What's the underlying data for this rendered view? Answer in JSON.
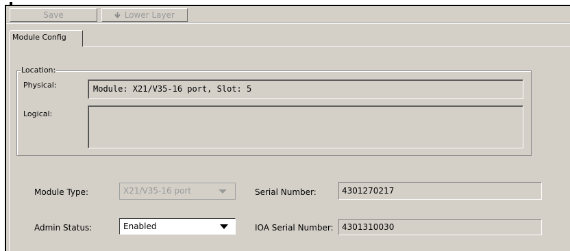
{
  "toolbar": {
    "save_label": "Save",
    "lower_layer_label": "Lower Layer",
    "lower_layer_icon": "down-arrow-icon"
  },
  "tabs": [
    {
      "label": "Module Config",
      "selected": true
    }
  ],
  "location": {
    "legend": "Location:",
    "physical_label": "Physical:",
    "physical_value": "Module: X21/V35-16 port, Slot: 5",
    "logical_label": "Logical:",
    "logical_value": ""
  },
  "form": {
    "module_type_label": "Module Type:",
    "module_type_value": "X21/V35-16 port",
    "admin_status_label": "Admin Status:",
    "admin_status_value": "Enabled",
    "serial_number_label": "Serial Number:",
    "serial_number_value": "4301270217",
    "ioa_serial_label": "IOA Serial Number:",
    "ioa_serial_value": "4301310030"
  },
  "colors": {
    "panel": "#d4d0c8",
    "disabled_text": "#9a9a9a"
  }
}
